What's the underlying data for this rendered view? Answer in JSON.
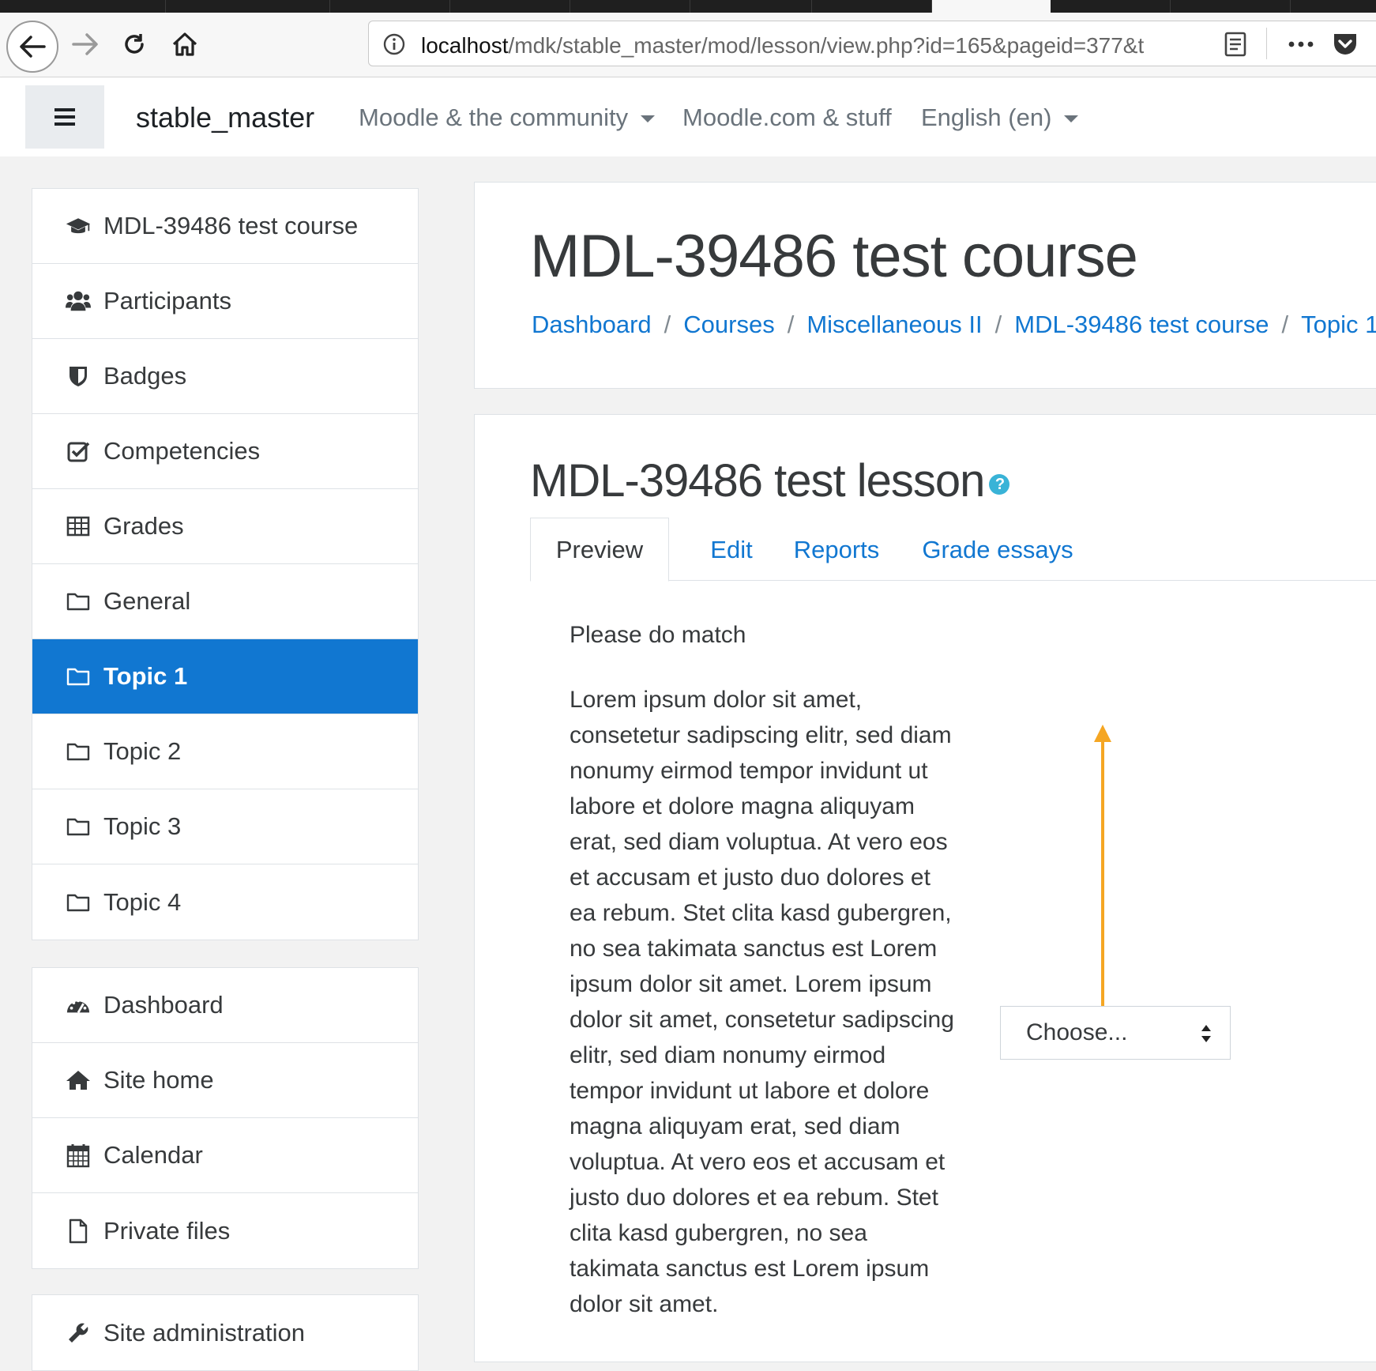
{
  "browser": {
    "url_host": "localhost",
    "url_path": "/mdk/stable_master/mod/lesson/view.php?id=165&pageid=377&t",
    "icons": [
      "back-arrow-icon",
      "forward-arrow-icon",
      "reload-icon",
      "home-icon",
      "info-icon",
      "reader-view-icon",
      "more-icon",
      "pocket-icon"
    ]
  },
  "navbar": {
    "site_name": "stable_master",
    "menu": [
      {
        "label": "Moodle & the community",
        "has_caret": true
      },
      {
        "label": "Moodle.com & stuff",
        "has_caret": false
      },
      {
        "label": "English (en)",
        "has_caret": true
      }
    ]
  },
  "sidebar": {
    "course_items": [
      {
        "label": "MDL-39486 test course",
        "icon": "graduation-cap-icon"
      },
      {
        "label": "Participants",
        "icon": "users-icon"
      },
      {
        "label": "Badges",
        "icon": "shield-icon"
      },
      {
        "label": "Competencies",
        "icon": "check-square-icon"
      },
      {
        "label": "Grades",
        "icon": "table-icon"
      },
      {
        "label": "General",
        "icon": "folder-icon"
      },
      {
        "label": "Topic 1",
        "icon": "folder-icon",
        "active": true
      },
      {
        "label": "Topic 2",
        "icon": "folder-icon"
      },
      {
        "label": "Topic 3",
        "icon": "folder-icon"
      },
      {
        "label": "Topic 4",
        "icon": "folder-icon"
      }
    ],
    "site_items": [
      {
        "label": "Dashboard",
        "icon": "tachometer-icon"
      },
      {
        "label": "Site home",
        "icon": "home-icon"
      },
      {
        "label": "Calendar",
        "icon": "calendar-icon"
      },
      {
        "label": "Private files",
        "icon": "file-icon"
      }
    ],
    "admin_items": [
      {
        "label": "Site administration",
        "icon": "wrench-icon"
      }
    ]
  },
  "header": {
    "course_title": "MDL-39486 test course",
    "breadcrumb": [
      "Dashboard",
      "Courses",
      "Miscellaneous II",
      "MDL-39486 test course",
      "Topic 1"
    ]
  },
  "lesson": {
    "title": "MDL-39486 test lesson",
    "help_icon": "?",
    "tabs": [
      {
        "label": "Preview",
        "active": true
      },
      {
        "label": "Edit"
      },
      {
        "label": "Reports"
      },
      {
        "label": "Grade essays"
      }
    ],
    "question": "Please do match",
    "answer_text": "Lorem ipsum dolor sit amet, consetetur sadipscing elitr, sed diam nonumy eirmod tempor invidunt ut labore et dolore magna aliquyam erat, sed diam voluptua. At vero eos et accusam et justo duo dolores et ea rebum. Stet clita kasd gubergren, no sea takimata sanctus est Lorem ipsum dolor sit amet. Lorem ipsum dolor sit amet, consetetur sadipscing elitr, sed diam nonumy eirmod tempor invidunt ut labore et dolore magna aliquyam erat, sed diam voluptua. At vero eos et accusam et justo duo dolores et ea rebum. Stet clita kasd gubergren, no sea takimata sanctus est Lorem ipsum dolor sit amet.",
    "select_value": "Choose..."
  },
  "colors": {
    "primary": "#1177d1",
    "annotation_arrow": "#f5a623",
    "help_icon": "#39b3d7"
  }
}
